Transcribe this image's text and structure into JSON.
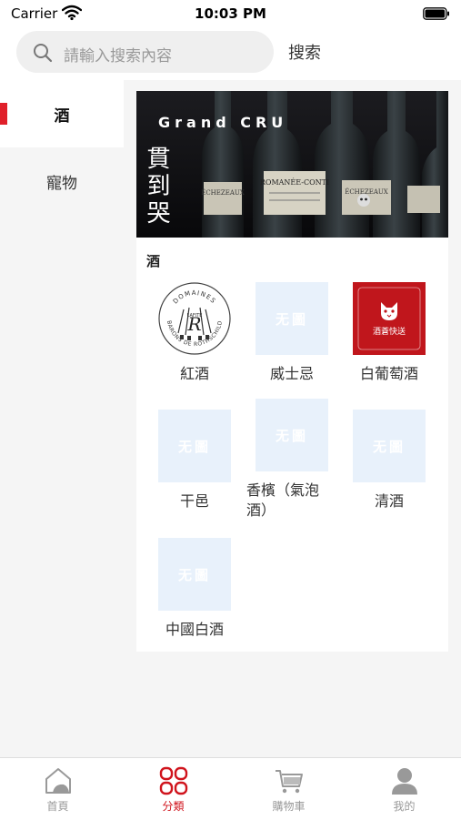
{
  "status_bar": {
    "carrier": "Carrier",
    "time": "10:03 PM"
  },
  "search": {
    "placeholder": "請輸入搜索內容",
    "button_label": "搜索"
  },
  "sidebar": {
    "items": [
      {
        "label": "酒",
        "active": true
      },
      {
        "label": "寵物",
        "active": false
      }
    ]
  },
  "banner": {
    "headline": "Grand CRU",
    "slogan": "貫到哭",
    "bottle_labels": [
      "ÉCHEZEAUX",
      "ROMANÉE-CONTI",
      "ÉCHEZEAUX"
    ]
  },
  "section": {
    "title": "酒",
    "categories": [
      {
        "label": "紅酒",
        "thumb": "rothschild-logo"
      },
      {
        "label": "威士忌",
        "thumb": "placeholder"
      },
      {
        "label": "白葡萄酒",
        "thumb": "red-cat-logo"
      },
      {
        "label": "干邑",
        "thumb": "placeholder"
      },
      {
        "label": "香檳（氣泡酒）",
        "thumb": "placeholder"
      },
      {
        "label": "清酒",
        "thumb": "placeholder"
      },
      {
        "label": "中國白酒",
        "thumb": "placeholder"
      }
    ],
    "placeholder_text": "无圖",
    "logos": {
      "rothschild_top": "DOMAINES",
      "rothschild_bottom": "BARONS DE ROTHSCHILD",
      "rothschild_letter": "R",
      "rothschild_small": "LAFITE",
      "cat_text": "酒蒼快送"
    }
  },
  "tab_bar": {
    "tabs": [
      {
        "label": "首頁",
        "icon": "home-icon",
        "active": false
      },
      {
        "label": "分類",
        "icon": "category-grid-icon",
        "active": true
      },
      {
        "label": "購物車",
        "icon": "cart-icon",
        "active": false
      },
      {
        "label": "我的",
        "icon": "profile-icon",
        "active": false
      }
    ]
  },
  "colors": {
    "accent": "#d0141d",
    "sidebar_bg": "#f5f5f5",
    "placeholder_bg": "#e8f1fb"
  }
}
